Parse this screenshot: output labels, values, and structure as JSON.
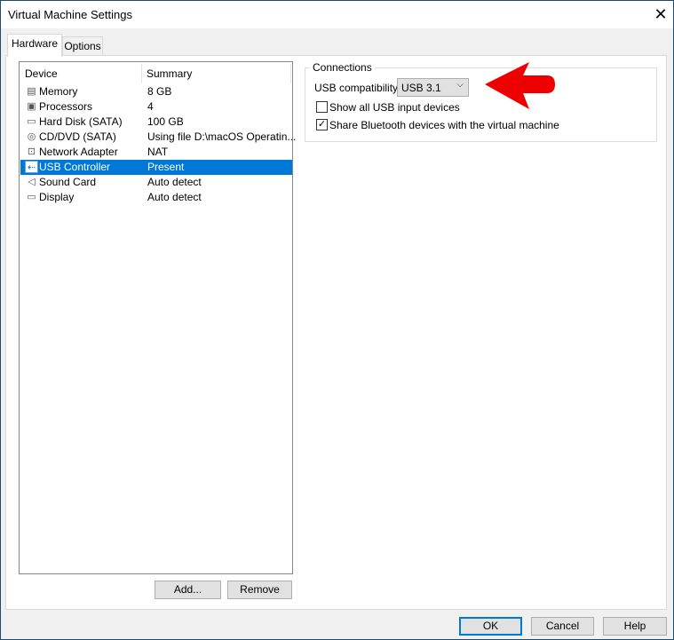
{
  "window": {
    "title": "Virtual Machine Settings",
    "close_icon": "close-icon"
  },
  "tabs": [
    {
      "label": "Hardware",
      "active": true
    },
    {
      "label": "Options",
      "active": false
    }
  ],
  "device_list": {
    "headers": [
      "Device",
      "Summary"
    ],
    "rows": [
      {
        "device": "Memory",
        "summary": "8 GB",
        "icon": "memory-icon"
      },
      {
        "device": "Processors",
        "summary": "4",
        "icon": "processor-icon"
      },
      {
        "device": "Hard Disk (SATA)",
        "summary": "100 GB",
        "icon": "hard-disk-icon"
      },
      {
        "device": "CD/DVD (SATA)",
        "summary": "Using file D:\\macOS Operatin...",
        "icon": "cd-dvd-icon"
      },
      {
        "device": "Network Adapter",
        "summary": "NAT",
        "icon": "network-adapter-icon"
      },
      {
        "device": "USB Controller",
        "summary": "Present",
        "icon": "usb-icon",
        "selected": true
      },
      {
        "device": "Sound Card",
        "summary": "Auto detect",
        "icon": "speaker-icon"
      },
      {
        "device": "Display",
        "summary": "Auto detect",
        "icon": "monitor-icon"
      }
    ],
    "add_label": "Add...",
    "remove_label": "Remove"
  },
  "connections": {
    "group_label": "Connections",
    "usb_compat_label": "USB compatibility:",
    "usb_compat_value": "USB 3.1",
    "show_all_usb": {
      "label": "Show all USB input devices",
      "checked": false
    },
    "share_bluetooth": {
      "label": "Share Bluetooth devices with the virtual machine",
      "checked": true
    }
  },
  "annotation": {
    "color": "#ee0000"
  },
  "footer": {
    "ok": "OK",
    "cancel": "Cancel",
    "help": "Help"
  },
  "colors": {
    "selection": "#0078d7"
  }
}
